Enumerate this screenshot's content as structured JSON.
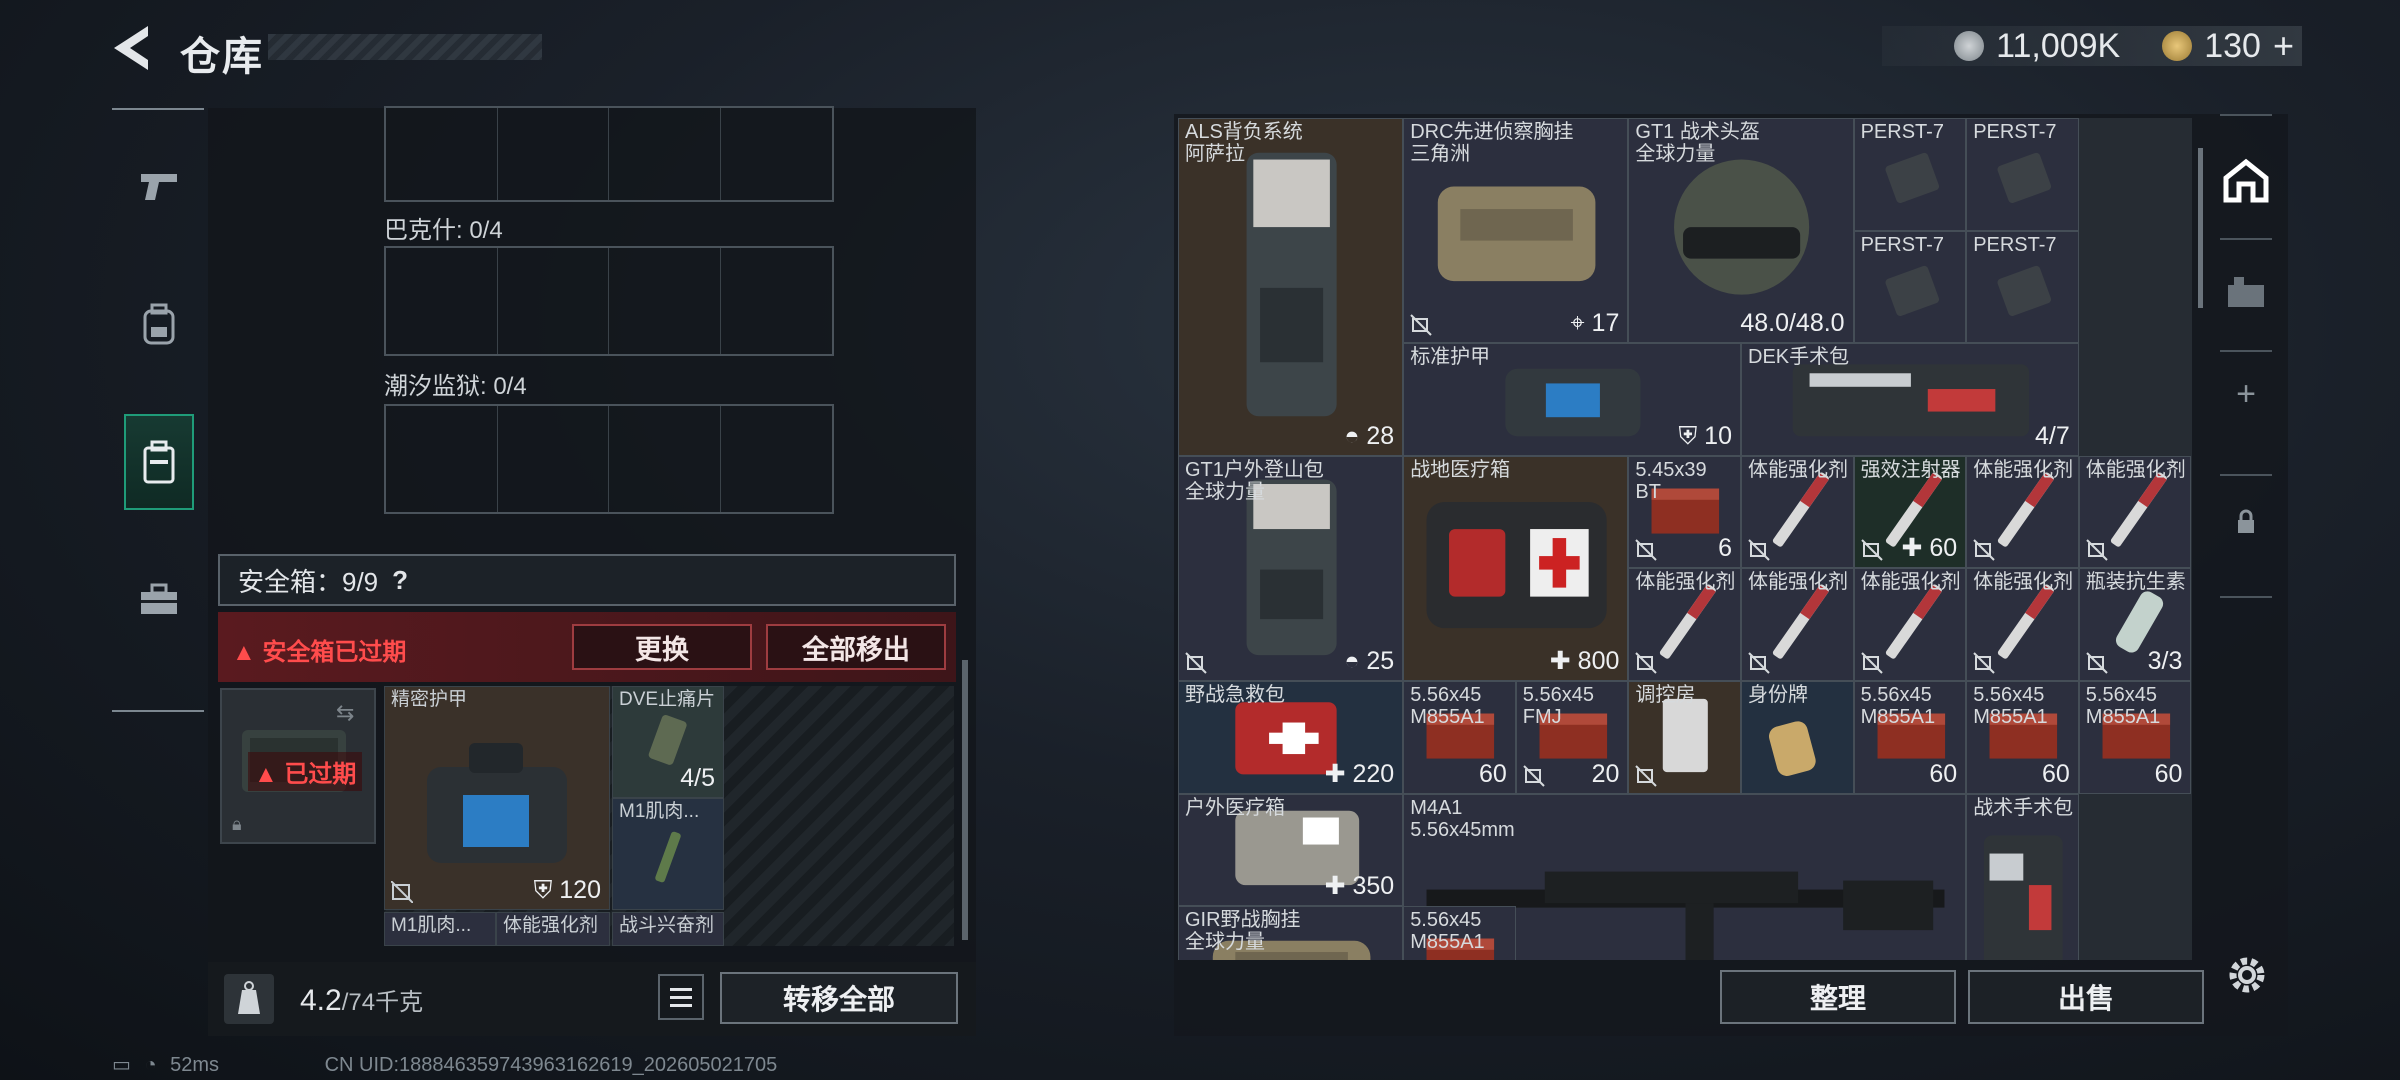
{
  "header": {
    "title": "仓库",
    "currency": [
      {
        "icon": "silver-coin-icon",
        "value": "11,009K"
      },
      {
        "icon": "gold-coin-icon",
        "value": "130"
      }
    ]
  },
  "left_tabs": [
    {
      "icon": "pistol-icon"
    },
    {
      "icon": "backpack-icon"
    },
    {
      "icon": "case-icon",
      "active": true
    },
    {
      "icon": "toolbox-icon"
    }
  ],
  "containers": {
    "bakeshi": "巴克什: 0/4",
    "chaoxi": "潮汐监狱: 0/4"
  },
  "safe": {
    "label": "安全箱：9/9",
    "help": "?",
    "expired_msg": "安全箱已过期",
    "replace": "更换",
    "move_all": "全部移出",
    "slot_tag": "已过期"
  },
  "case_items": [
    {
      "name": "精密护甲",
      "value": "120"
    },
    {
      "name": "DVE止痛片",
      "value": "4/5"
    },
    {
      "name": "M1肌肉...",
      "value": ""
    },
    {
      "name": "M1肌肉...",
      "value": ""
    },
    {
      "name": "体能强化剂",
      "value": ""
    },
    {
      "name": "战斗兴奋剂",
      "value": ""
    }
  ],
  "weight": {
    "current": "4.2",
    "max": "/74千克",
    "transfer_all": "转移全部"
  },
  "status": {
    "ping": "52ms",
    "uid": "CN UID:18884635974396316261​9_202605021705"
  },
  "stash": [
    {
      "name": "ALS背负系统\n阿萨拉",
      "value": "28"
    },
    {
      "name": "DRC先进侦察胸挂\n三角洲",
      "value": "17"
    },
    {
      "name": "GT1 战术头盔\n全球力量",
      "value": "48.0/48.0"
    },
    {
      "name": "PERST-7",
      "value": ""
    },
    {
      "name": "PERST-7",
      "value": ""
    },
    {
      "name": "PERST-7",
      "value": ""
    },
    {
      "name": "PERST-7",
      "value": ""
    },
    {
      "name": "标准护甲",
      "value": "10"
    },
    {
      "name": "DEK手术包",
      "value": "4/7"
    },
    {
      "name": "GT1户外登山包\n全球力量",
      "value": "25"
    },
    {
      "name": "战地医疗箱",
      "value": "800"
    },
    {
      "name": "5.45x39\nBT",
      "value": "6"
    },
    {
      "name": "体能强化剂",
      "value": ""
    },
    {
      "name": "强效注射器",
      "value": "60"
    },
    {
      "name": "体能强化剂",
      "value": ""
    },
    {
      "name": "体能强化剂",
      "value": ""
    },
    {
      "name": "体能强化剂",
      "value": ""
    },
    {
      "name": "体能强化剂",
      "value": ""
    },
    {
      "name": "体能强化剂",
      "value": ""
    },
    {
      "name": "体能强化剂",
      "value": ""
    },
    {
      "name": "瓶装抗生素",
      "value": "3/3"
    },
    {
      "name": "野战急救包",
      "value": "220"
    },
    {
      "name": "5.56x45\nM855A1",
      "value": "60"
    },
    {
      "name": "5.56x45\nFMJ",
      "value": "20"
    },
    {
      "name": "调控房",
      "value": ""
    },
    {
      "name": "身份牌",
      "value": ""
    },
    {
      "name": "5.56x45\nM855A1",
      "value": "60"
    },
    {
      "name": "5.56x45\nM855A1",
      "value": "60"
    },
    {
      "name": "5.56x45\nM855A1",
      "value": "60"
    },
    {
      "name": "户外医疗箱",
      "value": "350"
    },
    {
      "name": "M4A1\n5.56x45mm",
      "value": ""
    },
    {
      "name": "战术手术包",
      "value": ""
    },
    {
      "name": "GIR野战胸挂\n全球力量",
      "value": ""
    },
    {
      "name": "5.56x45\nM855A1",
      "value": ""
    }
  ],
  "actions": {
    "sort": "整理",
    "sell": "出售"
  },
  "colors": {
    "accent": "#1f9c79",
    "expired_red": "#ff4c4c",
    "cell_purple": "#2c2f3e"
  }
}
